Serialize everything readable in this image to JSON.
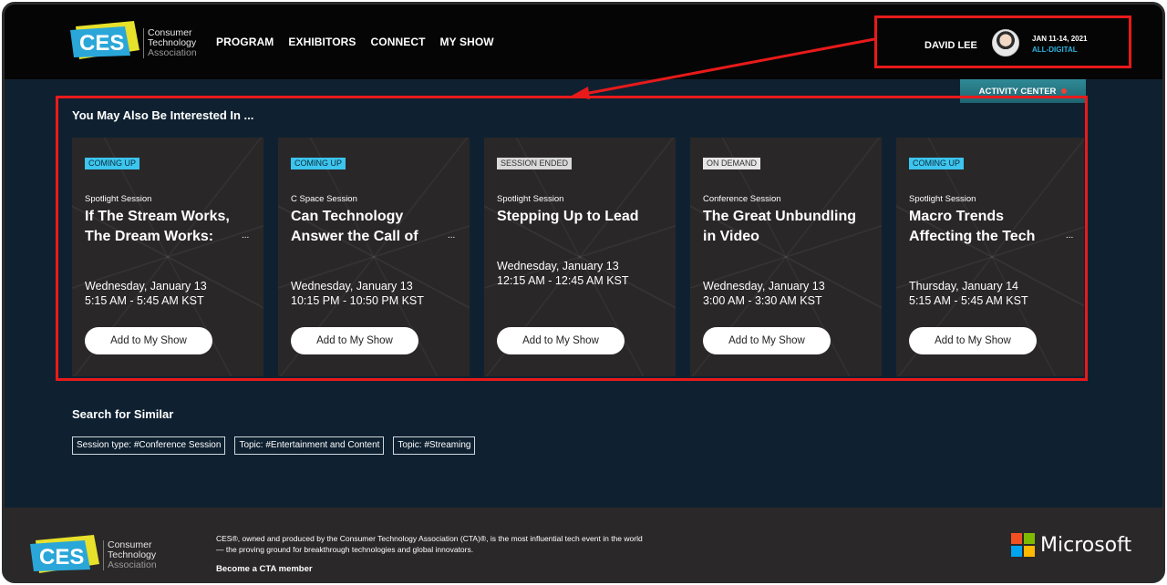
{
  "header": {
    "logo_mark": "CES",
    "logo_text": [
      "Consumer",
      "Technology",
      "Association"
    ],
    "nav": [
      "PROGRAM",
      "EXHIBITORS",
      "CONNECT",
      "MY SHOW"
    ],
    "user_name": "DAVID LEE",
    "event_dates": "JAN 11-14, 2021",
    "event_mode": "ALL-DIGITAL",
    "activity_center": "ACTIVITY CENTER"
  },
  "recommendations": {
    "title": "You May Also Be Interested In ...",
    "cards": [
      {
        "status": "COMING UP",
        "type": "Spotlight Session",
        "title": "If The Stream Works, The Dream Works:",
        "more": "...",
        "date": "Wednesday, January 13",
        "time": "5:15 AM - 5:45 AM KST",
        "button": "Add to My Show"
      },
      {
        "status": "COMING UP",
        "type": "C Space Session",
        "title": "Can Technology Answer the Call of",
        "more": "...",
        "date": "Wednesday, January 13",
        "time": "10:15 PM - 10:50 PM KST",
        "button": "Add to My Show"
      },
      {
        "status": "SESSION ENDED",
        "type": "Spotlight Session",
        "title": "Stepping Up to Lead",
        "more": "",
        "date": "Wednesday, January 13",
        "time": "12:15 AM - 12:45 AM KST",
        "button": "Add to My Show"
      },
      {
        "status": "ON DEMAND",
        "type": "Conference Session",
        "title": "The Great Unbundling in Video",
        "more": "",
        "date": "Wednesday, January 13",
        "time": "3:00 AM - 3:30 AM KST",
        "button": "Add to My Show"
      },
      {
        "status": "COMING UP",
        "type": "Spotlight Session",
        "title": "Macro Trends Affecting the Tech",
        "more": "...",
        "date": "Thursday, January 14",
        "time": "5:15 AM - 5:45 AM KST",
        "button": "Add to My Show"
      }
    ]
  },
  "similar": {
    "title": "Search for Similar",
    "tags": [
      "Session type: #Conference Session",
      "Topic: #Entertainment and Content",
      "Topic: #Streaming"
    ]
  },
  "footer": {
    "text": "CES®, owned and produced by the Consumer Technology Association (CTA)®, is the most influential tech event in the world — the proving ground for breakthrough technologies and global innovators.",
    "cta_link": "Become a CTA member",
    "sponsor": "Microsoft"
  },
  "colors": {
    "annotation_red": "#e81a1a",
    "coming_up": "#3cc5ef",
    "page_bg": "#0f2131",
    "accent_teal": "#2e8a96"
  }
}
